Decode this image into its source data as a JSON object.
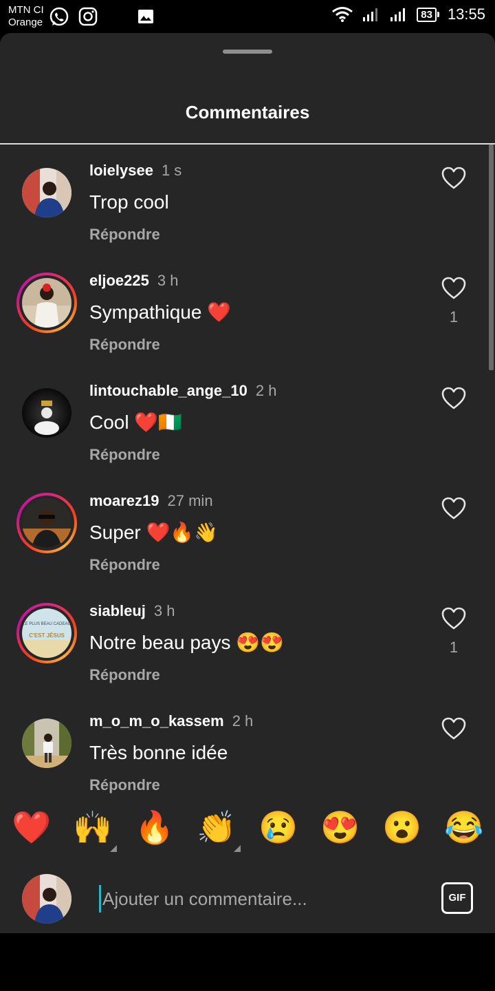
{
  "status_bar": {
    "carrier_line1": "MTN CI",
    "carrier_line2": "Orange",
    "app_icons": [
      "whatsapp-icon",
      "instagram-icon",
      "gallery-icon"
    ],
    "battery": "83",
    "time": "13:55"
  },
  "sheet": {
    "title": "Commentaires"
  },
  "comments": [
    {
      "username": "loielysee",
      "time": "1 s",
      "text": "Trop cool",
      "reply": "Répondre",
      "likes": ""
    },
    {
      "username": "eljoe225",
      "time": "3 h",
      "text": "Sympathique ❤️",
      "reply": "Répondre",
      "likes": "1"
    },
    {
      "username": "lintouchable_ange_10",
      "time": "2 h",
      "text": "Cool ❤️🇨🇮",
      "reply": "Répondre",
      "likes": ""
    },
    {
      "username": "moarez19",
      "time": "27 min",
      "text": "Super ❤️🔥👋",
      "reply": "Répondre",
      "likes": ""
    },
    {
      "username": "siableuj",
      "time": "3 h",
      "text": "Notre beau pays 😍😍",
      "reply": "Répondre",
      "likes": "1"
    },
    {
      "username": "m_o_m_o_kassem",
      "time": "2 h",
      "text": "Très bonne idée",
      "reply": "Répondre",
      "likes": ""
    }
  ],
  "avatar_texts": {
    "siableuj": [
      "LE PLUS BEAU CADEAU",
      "C'EST JÉSUS"
    ]
  },
  "emoji_bar": [
    "❤️",
    "🙌",
    "🔥",
    "👏",
    "😢",
    "😍",
    "😮",
    "😂"
  ],
  "composer": {
    "placeholder": "Ajouter un commentaire...",
    "gif_label": "GIF"
  },
  "colors": {
    "sheet_bg": "#262626",
    "secondary_text": "#a8a8a8",
    "story_ring": "#d8228b",
    "cursor": "#2bb5c9"
  }
}
